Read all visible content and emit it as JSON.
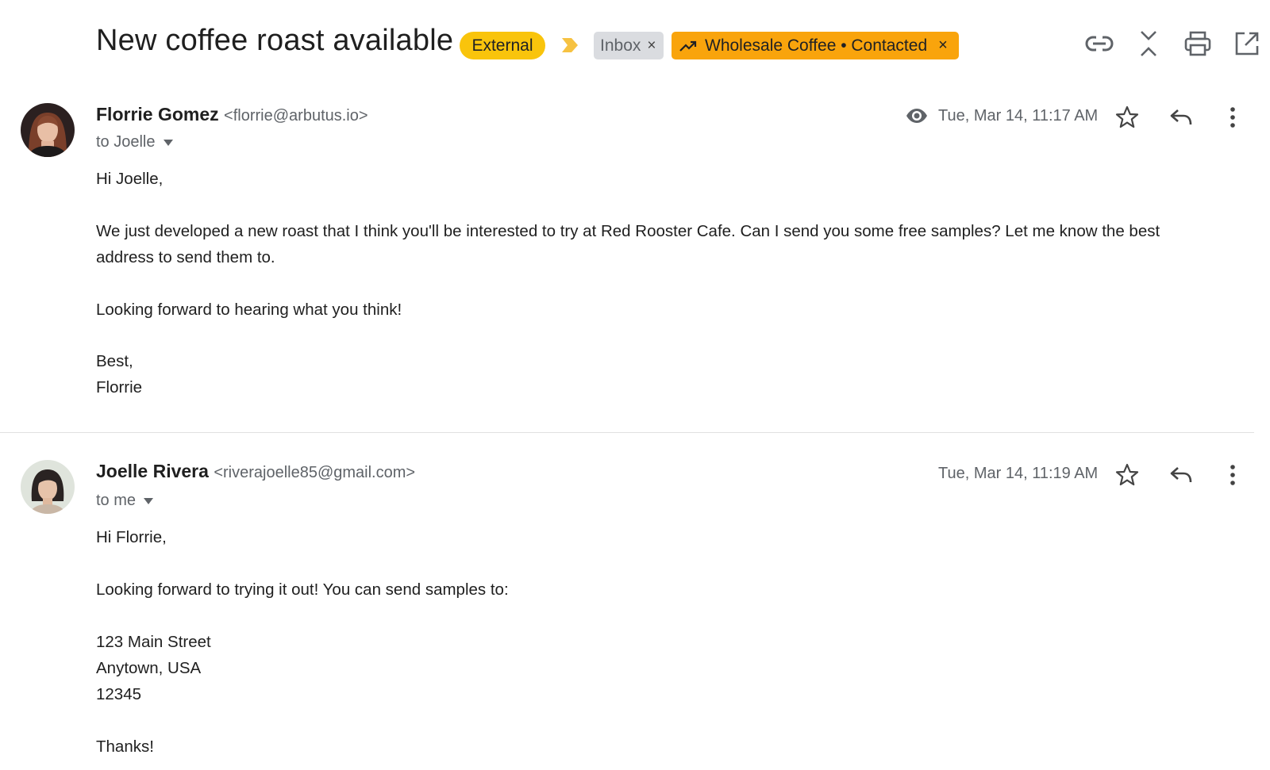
{
  "thread": {
    "subject": "New coffee roast available",
    "labels": {
      "external": "External",
      "inbox": "Inbox",
      "wholesale": "Wholesale Coffee • Contacted",
      "remove_glyph": "×"
    },
    "toolbar_icons": [
      "link-icon",
      "collapse-icon",
      "print-icon",
      "open-new-window-icon"
    ]
  },
  "messages": [
    {
      "sender_name": "Florrie Gomez",
      "sender_email": "<florrie@arbutus.io>",
      "to": "to Joelle",
      "date": "Tue, Mar 14, 11:17 AM",
      "body": [
        "Hi Joelle,",
        "We just developed a new roast that I think you'll be interested to try at Red Rooster Cafe. Can I send you some free samples? Let me know the best",
        "address to send them to.",
        "Looking forward to hearing what you think!",
        "Best,",
        "Florrie"
      ]
    },
    {
      "sender_name": "Joelle Rivera",
      "sender_email": "<riverajoelle85@gmail.com>",
      "to": "to me",
      "date": "Tue, Mar 14, 11:19 AM",
      "body": [
        "Hi Florrie,",
        "Looking forward to trying it out! You can send samples to:",
        "123 Main Street",
        "Anytown, USA",
        "12345",
        "Thanks!"
      ]
    }
  ],
  "colors": {
    "external_chip": "#f9c40c",
    "wholesale_chip": "#f9a40c",
    "inbox_chip": "#dadce0",
    "icon_gray": "#5f6368"
  }
}
